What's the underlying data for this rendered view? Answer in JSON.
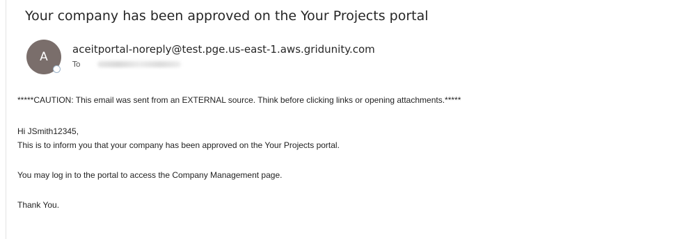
{
  "email": {
    "subject": "Your company has been approved on the Your Projects portal",
    "sender": {
      "avatar_initial": "A",
      "address": "aceitportal-noreply@test.pge.us-east-1.aws.gridunity.com",
      "to_label": "To"
    },
    "body": {
      "caution": "*****CAUTION: This email was sent from an EXTERNAL source. Think before clicking links or opening attachments.*****",
      "greeting": "Hi JSmith12345,",
      "line1": "This is to inform you that your company has been approved on the Your Projects portal.",
      "line2": "You may log in to the portal to access the Company Management page.",
      "closing": "Thank You."
    }
  }
}
